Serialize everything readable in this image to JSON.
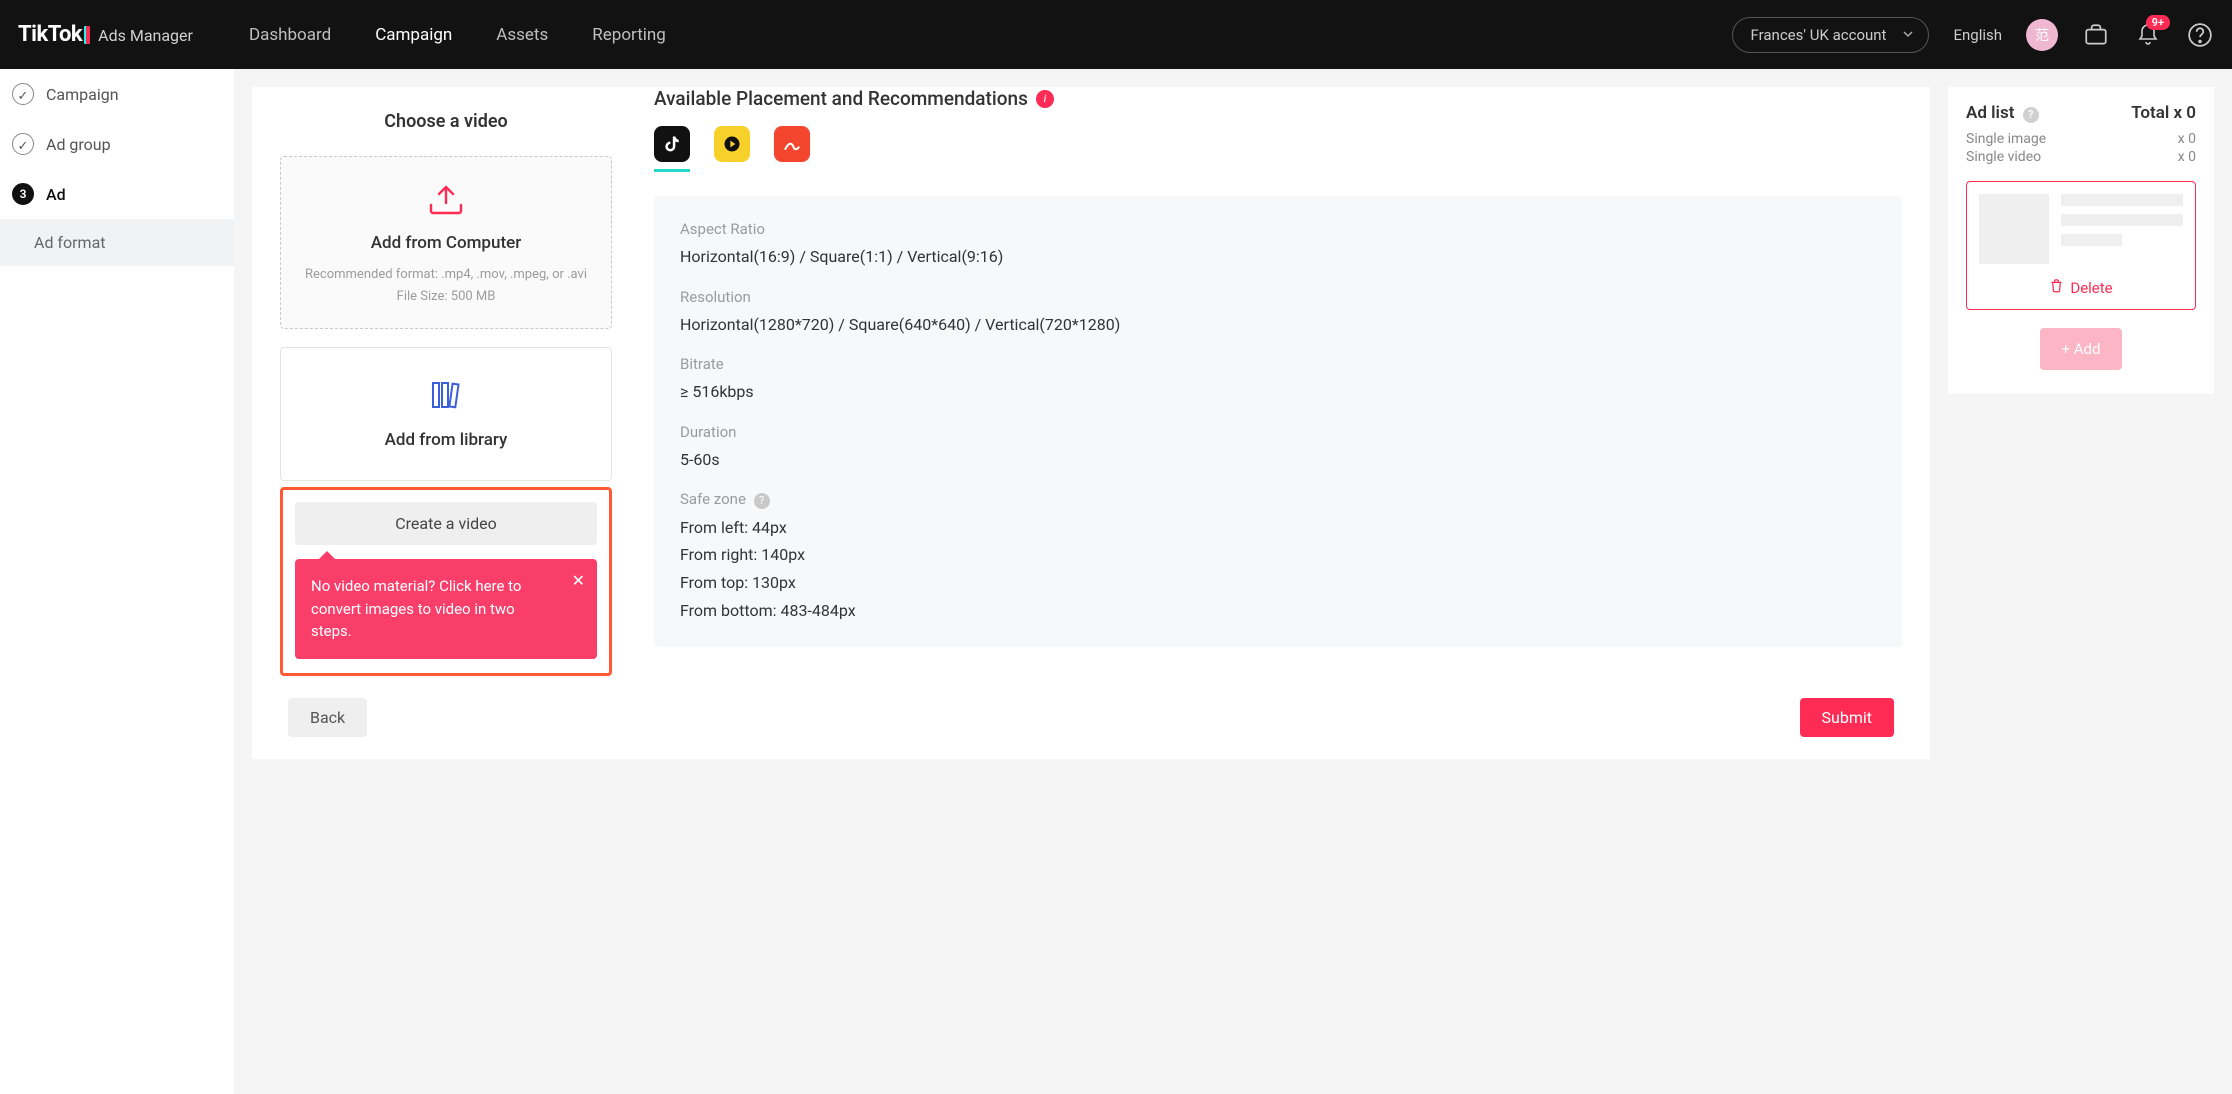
{
  "brand": {
    "name": "TikTok",
    "sub": "Ads Manager"
  },
  "nav": {
    "dashboard": "Dashboard",
    "campaign": "Campaign",
    "assets": "Assets",
    "reporting": "Reporting"
  },
  "account": {
    "selected": "Frances' UK account",
    "language": "English",
    "avatar_text": "范",
    "bell_badge": "9+"
  },
  "steps": {
    "campaign": "Campaign",
    "adgroup": "Ad group",
    "ad": "Ad",
    "ad_num": "3",
    "sub": "Ad format"
  },
  "choose": {
    "title": "Choose a video",
    "upload_title": "Add from Computer",
    "upload_sub1": "Recommended format: .mp4, .mov, .mpeg, or .avi",
    "upload_sub2": "File Size: 500 MB",
    "library_title": "Add from library",
    "create_label": "Create a video",
    "tooltip": "No video material? Click here to convert images to video in two steps."
  },
  "placements": {
    "heading": "Available Placement and Recommendations",
    "specs": {
      "aspect_label": "Aspect Ratio",
      "aspect_val": "Horizontal(16:9) / Square(1:1) / Vertical(9:16)",
      "res_label": "Resolution",
      "res_val": "Horizontal(1280*720) / Square(640*640) / Vertical(720*1280)",
      "bitrate_label": "Bitrate",
      "bitrate_val": "≥ 516kbps",
      "duration_label": "Duration",
      "duration_val": "5-60s",
      "safe_label": "Safe zone",
      "safe_left": "From left: 44px",
      "safe_right": "From right: 140px",
      "safe_top": "From top: 130px",
      "safe_bottom": "From bottom: 483-484px"
    }
  },
  "footer": {
    "back": "Back",
    "submit": "Submit"
  },
  "adlist": {
    "title": "Ad list",
    "total": "Total x 0",
    "single_image": "Single image",
    "single_image_n": "x 0",
    "single_video": "Single video",
    "single_video_n": "x 0",
    "delete": "Delete",
    "add": "+ Add"
  }
}
